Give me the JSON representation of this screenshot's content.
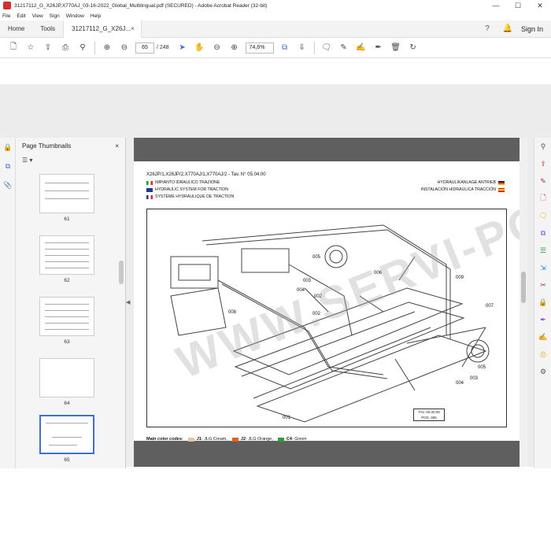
{
  "window": {
    "title": "31217112_G_X26JP,X770AJ_03-16-2022_Global_Multilingual.pdf (SECURED) - Adobe Acrobat Reader (32-bit)",
    "minimize": "—",
    "maximize": "☐",
    "close": "✕"
  },
  "menu": [
    "File",
    "Edit",
    "View",
    "Sign",
    "Window",
    "Help"
  ],
  "tabs": {
    "home": "Home",
    "tools": "Tools",
    "doc": "31217112_G_X26J...",
    "doc_close": "×",
    "sign_in": "Sign In"
  },
  "toolbar": {
    "page_current": "65",
    "page_total": "/ 248",
    "zoom": "74,6%"
  },
  "thumbnails": {
    "title": "Page Thumbnails",
    "close": "×",
    "options": "☰ ▾",
    "pages": [
      "61",
      "62",
      "63",
      "64",
      "65"
    ],
    "selected": "65"
  },
  "document": {
    "header": "X26JP/1,X26JP/2,X770AJ/1,X770AJ/2 - Tav. N° 05.04.00",
    "lang_it": "IMPIANTO IDRAULICO TRAZIONE",
    "lang_en": "HYDRAULIC SYSTEM FOR TRACTION",
    "lang_fr": "SYSTÈME HYDRAULIQUE DE TRACTION",
    "lang_de": "HYDRAULIKANLAGE ANTRIEB",
    "lang_es": "INSTALACIÓN HIDRÁULICA TRACCIÓN",
    "callouts": [
      "001",
      "002",
      "003",
      "004",
      "005",
      "006",
      "007",
      "008",
      "009",
      "002",
      "003",
      "004",
      "005"
    ],
    "tav_box": [
      "TAV. 05.00.00",
      "POS. 005"
    ],
    "color_codes_label": "Main color codes:",
    "color_codes": [
      {
        "code": "J1",
        "name": " - JLG Cream,",
        "color": "#e1c89a"
      },
      {
        "code": "J2",
        "name": " - JLG Orange,",
        "color": "#e0601b"
      },
      {
        "code": "C4",
        "name": " - Green",
        "color": "#2e9e3a"
      }
    ],
    "watermark": "WWW.SERVI-PO.COM"
  },
  "colors": {
    "accent": "#3f6fd1",
    "acrobat_red": "#d32f2f",
    "doc_bg": "#5f5f5f"
  }
}
